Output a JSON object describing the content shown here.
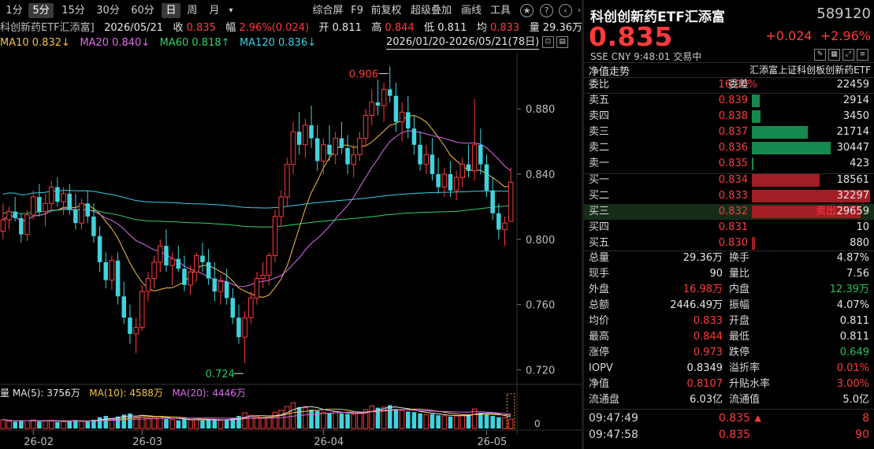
{
  "toolbar": {
    "periods": [
      "1分",
      "5分",
      "15分",
      "30分",
      "60分",
      "日",
      "周",
      "月"
    ],
    "active_period": "日",
    "tools": [
      "综合屏",
      "F9",
      "前复权",
      "超级叠加",
      "画线",
      "工具"
    ],
    "icons": [
      "star-icon",
      "help-icon",
      "chevron-left-icon",
      "chevron-right-icon"
    ]
  },
  "info": {
    "name": "科创新药ETF汇添富]",
    "date": "2026/05/21",
    "close_label": "收",
    "close": "0.835",
    "amp_label": "幅",
    "amp": "2.96%(0.024)",
    "open_label": "开",
    "open": "0.811",
    "high_label": "高",
    "high": "0.844",
    "low_label": "低",
    "low": "0.811",
    "avg_label": "均",
    "avg": "0.833",
    "vol_label": "量",
    "vol": "29.36万",
    "ma10": "MA10 0.832↓",
    "ma20": "MA20 0.840↓",
    "ma60": "MA60 0.818↑",
    "ma120": "MA120 0.836↓",
    "range": "2026/01/20-2026/05/21(78日)"
  },
  "volume_legend": {
    "vol_label": "量",
    "ma5": "MA(5): 3756万",
    "ma10": "MA(10): 4588万",
    "ma20": "MA(20): 4446万"
  },
  "chart_data": {
    "type": "candlestick",
    "y_ticks": [
      "0.880",
      "0.840",
      "0.800",
      "0.760",
      "0.720"
    ],
    "y_tick_values": [
      0.88,
      0.84,
      0.8,
      0.76,
      0.72
    ],
    "ylim": [
      0.712,
      0.912
    ],
    "x_labels": [
      "26-02",
      "26-03",
      "26-04",
      "26-05"
    ],
    "x_label_index": [
      5,
      23,
      53,
      80
    ],
    "max_label": "0.906",
    "min_label": "0.724",
    "max_index": 64,
    "min_index": 40,
    "vol_ticks": [
      "0"
    ],
    "vol_max": 1.0,
    "ohlc": [
      [
        0.805,
        0.822,
        0.8,
        0.812
      ],
      [
        0.812,
        0.82,
        0.806,
        0.817
      ],
      [
        0.817,
        0.826,
        0.811,
        0.813
      ],
      [
        0.813,
        0.816,
        0.798,
        0.803
      ],
      [
        0.803,
        0.818,
        0.799,
        0.815
      ],
      [
        0.815,
        0.83,
        0.812,
        0.826
      ],
      [
        0.826,
        0.834,
        0.814,
        0.817
      ],
      [
        0.817,
        0.828,
        0.808,
        0.822
      ],
      [
        0.822,
        0.836,
        0.818,
        0.832
      ],
      [
        0.832,
        0.838,
        0.82,
        0.823
      ],
      [
        0.823,
        0.832,
        0.815,
        0.828
      ],
      [
        0.828,
        0.834,
        0.815,
        0.818
      ],
      [
        0.818,
        0.828,
        0.806,
        0.81
      ],
      [
        0.81,
        0.825,
        0.806,
        0.822
      ],
      [
        0.822,
        0.83,
        0.81,
        0.814
      ],
      [
        0.814,
        0.822,
        0.798,
        0.802
      ],
      [
        0.802,
        0.808,
        0.78,
        0.786
      ],
      [
        0.786,
        0.792,
        0.77,
        0.775
      ],
      [
        0.775,
        0.79,
        0.769,
        0.787
      ],
      [
        0.787,
        0.792,
        0.76,
        0.765
      ],
      [
        0.765,
        0.774,
        0.748,
        0.752
      ],
      [
        0.752,
        0.76,
        0.736,
        0.742
      ],
      [
        0.742,
        0.752,
        0.73,
        0.746
      ],
      [
        0.746,
        0.772,
        0.744,
        0.768
      ],
      [
        0.768,
        0.78,
        0.762,
        0.776
      ],
      [
        0.776,
        0.79,
        0.77,
        0.786
      ],
      [
        0.786,
        0.8,
        0.78,
        0.796
      ],
      [
        0.796,
        0.806,
        0.78,
        0.784
      ],
      [
        0.784,
        0.792,
        0.772,
        0.788
      ],
      [
        0.788,
        0.796,
        0.78,
        0.782
      ],
      [
        0.782,
        0.79,
        0.768,
        0.772
      ],
      [
        0.772,
        0.784,
        0.766,
        0.78
      ],
      [
        0.78,
        0.792,
        0.774,
        0.79
      ],
      [
        0.79,
        0.798,
        0.78,
        0.786
      ],
      [
        0.786,
        0.794,
        0.772,
        0.776
      ],
      [
        0.776,
        0.786,
        0.762,
        0.768
      ],
      [
        0.768,
        0.778,
        0.76,
        0.774
      ],
      [
        0.774,
        0.782,
        0.76,
        0.764
      ],
      [
        0.764,
        0.77,
        0.748,
        0.752
      ],
      [
        0.752,
        0.76,
        0.736,
        0.74
      ],
      [
        0.74,
        0.756,
        0.724,
        0.752
      ],
      [
        0.752,
        0.768,
        0.748,
        0.764
      ],
      [
        0.764,
        0.78,
        0.76,
        0.776
      ],
      [
        0.776,
        0.786,
        0.77,
        0.778
      ],
      [
        0.778,
        0.792,
        0.772,
        0.79
      ],
      [
        0.79,
        0.818,
        0.786,
        0.814
      ],
      [
        0.814,
        0.83,
        0.808,
        0.826
      ],
      [
        0.826,
        0.85,
        0.82,
        0.846
      ],
      [
        0.846,
        0.872,
        0.84,
        0.866
      ],
      [
        0.866,
        0.878,
        0.852,
        0.858
      ],
      [
        0.858,
        0.874,
        0.85,
        0.87
      ],
      [
        0.87,
        0.882,
        0.856,
        0.862
      ],
      [
        0.862,
        0.87,
        0.842,
        0.848
      ],
      [
        0.848,
        0.862,
        0.84,
        0.858
      ],
      [
        0.858,
        0.87,
        0.848,
        0.852
      ],
      [
        0.852,
        0.866,
        0.846,
        0.862
      ],
      [
        0.862,
        0.872,
        0.852,
        0.856
      ],
      [
        0.856,
        0.864,
        0.84,
        0.846
      ],
      [
        0.846,
        0.858,
        0.838,
        0.852
      ],
      [
        0.852,
        0.866,
        0.848,
        0.862
      ],
      [
        0.862,
        0.88,
        0.858,
        0.876
      ],
      [
        0.876,
        0.892,
        0.87,
        0.884
      ],
      [
        0.884,
        0.898,
        0.876,
        0.882
      ],
      [
        0.882,
        0.896,
        0.872,
        0.892
      ],
      [
        0.892,
        0.906,
        0.884,
        0.888
      ],
      [
        0.888,
        0.896,
        0.866,
        0.872
      ],
      [
        0.872,
        0.884,
        0.86,
        0.878
      ],
      [
        0.878,
        0.888,
        0.862,
        0.868
      ],
      [
        0.868,
        0.876,
        0.852,
        0.858
      ],
      [
        0.858,
        0.866,
        0.842,
        0.846
      ],
      [
        0.846,
        0.858,
        0.84,
        0.852
      ],
      [
        0.852,
        0.862,
        0.836,
        0.84
      ],
      [
        0.84,
        0.85,
        0.828,
        0.832
      ],
      [
        0.832,
        0.844,
        0.826,
        0.84
      ],
      [
        0.84,
        0.848,
        0.826,
        0.83
      ],
      [
        0.83,
        0.842,
        0.824,
        0.838
      ],
      [
        0.838,
        0.85,
        0.832,
        0.846
      ],
      [
        0.846,
        0.858,
        0.838,
        0.842
      ],
      [
        0.842,
        0.886,
        0.836,
        0.858
      ],
      [
        0.858,
        0.868,
        0.84,
        0.846
      ],
      [
        0.846,
        0.852,
        0.826,
        0.83
      ],
      [
        0.83,
        0.838,
        0.812,
        0.816
      ],
      [
        0.816,
        0.822,
        0.8,
        0.806
      ],
      [
        0.806,
        0.814,
        0.796,
        0.81
      ],
      [
        0.811,
        0.844,
        0.811,
        0.835
      ]
    ],
    "volumes": [
      0.28,
      0.24,
      0.22,
      0.26,
      0.25,
      0.27,
      0.22,
      0.24,
      0.26,
      0.21,
      0.22,
      0.24,
      0.27,
      0.23,
      0.22,
      0.28,
      0.36,
      0.4,
      0.31,
      0.38,
      0.44,
      0.48,
      0.36,
      0.42,
      0.33,
      0.35,
      0.38,
      0.3,
      0.28,
      0.26,
      0.3,
      0.27,
      0.28,
      0.25,
      0.27,
      0.3,
      0.26,
      0.29,
      0.34,
      0.4,
      0.5,
      0.42,
      0.38,
      0.34,
      0.36,
      0.52,
      0.58,
      0.7,
      0.82,
      0.68,
      0.66,
      0.6,
      0.56,
      0.52,
      0.5,
      0.54,
      0.48,
      0.46,
      0.44,
      0.5,
      0.6,
      0.72,
      0.66,
      0.68,
      0.74,
      0.62,
      0.58,
      0.54,
      0.52,
      0.48,
      0.44,
      0.46,
      0.42,
      0.4,
      0.38,
      0.4,
      0.42,
      0.44,
      0.62,
      0.5,
      0.44,
      0.4,
      0.36,
      0.34,
      0.3
    ],
    "ma_lines": {
      "ma10": {
        "color": "#f5c242",
        "last": 0.832
      },
      "ma20": {
        "color": "#e06bf0",
        "last": 0.84
      },
      "ma60": {
        "color": "#2fd36b",
        "last": 0.818
      },
      "ma120": {
        "color": "#35d0e6",
        "last": 0.836
      }
    }
  },
  "quote": {
    "title": "科创创新药ETF汇添富",
    "code": "589120",
    "price": "0.835",
    "change": "+0.024",
    "change_pct": "+2.96%",
    "meta": "SSE  CNY  9:48:01  交易中",
    "nav_trend": "净值走势",
    "fund_full_name": "汇添富上证科创板创新药ETF",
    "commit_ratio_label": "委比",
    "commit_ratio": "16.00%",
    "commit_diff_label": "委差",
    "commit_diff": "22459",
    "asks": [
      {
        "label": "卖五",
        "price": "0.839",
        "vol": "2914",
        "ratio": 0.096
      },
      {
        "label": "卖四",
        "price": "0.838",
        "vol": "3450",
        "ratio": 0.113
      },
      {
        "label": "卖三",
        "price": "0.837",
        "vol": "21714",
        "ratio": 0.713
      },
      {
        "label": "卖二",
        "price": "0.836",
        "vol": "30447",
        "ratio": 1.0
      },
      {
        "label": "卖一",
        "price": "0.835",
        "vol": "423",
        "ratio": 0.014
      }
    ],
    "bids": [
      {
        "label": "买一",
        "price": "0.834",
        "vol": "18561",
        "ratio": 0.575
      },
      {
        "label": "买二",
        "price": "0.833",
        "vol": "32297",
        "ratio": 1.0
      },
      {
        "label": "买三",
        "price": "0.832",
        "vol": "29659",
        "ratio": 0.918,
        "tag": "卖出"
      },
      {
        "label": "买四",
        "price": "0.831",
        "vol": "10",
        "ratio": 0.0
      },
      {
        "label": "买五",
        "price": "0.830",
        "vol": "880",
        "ratio": 0.027
      }
    ],
    "stats": [
      {
        "k": "总量",
        "v": "29.36万",
        "c": "#e6e6e6",
        "k2": "换手",
        "v2": "4.87%",
        "c2": "#e6e6e6"
      },
      {
        "k": "现手",
        "v": "90",
        "c": "#e6e6e6",
        "k2": "量比",
        "v2": "7.56",
        "c2": "#e6e6e6"
      },
      {
        "k": "外盘",
        "v": "16.98万",
        "c": "#ff3b3b",
        "k2": "内盘",
        "v2": "12.39万",
        "c2": "#22c55e"
      },
      {
        "k": "总额",
        "v": "2446.49万",
        "c": "#e6e6e6",
        "k2": "振幅",
        "v2": "4.07%",
        "c2": "#e6e6e6"
      },
      {
        "k": "均价",
        "v": "0.833",
        "c": "#ff3b3b",
        "k2": "开盘",
        "v2": "0.811",
        "c2": "#e6e6e6"
      },
      {
        "k": "最高",
        "v": "0.844",
        "c": "#ff3b3b",
        "k2": "最低",
        "v2": "0.811",
        "c2": "#e6e6e6"
      },
      {
        "k": "涨停",
        "v": "0.973",
        "c": "#ff3b3b",
        "k2": "跌停",
        "v2": "0.649",
        "c2": "#22c55e"
      },
      {
        "k": "IOPV",
        "v": "0.8349",
        "c": "#e6e6e6",
        "k2": "溢折率",
        "v2": "0.01%",
        "c2": "#ff3b3b"
      },
      {
        "k": "净值",
        "v": "0.8107",
        "c": "#ff3b3b",
        "k2": "升贴水率",
        "v2": "3.00%",
        "c2": "#ff3b3b"
      },
      {
        "k": "流通盘",
        "v": "6.03亿",
        "c": "#e6e6e6",
        "k2": "流通值",
        "v2": "5.0亿",
        "c2": "#e6e6e6"
      }
    ],
    "ticks": [
      {
        "time": "09:47:49",
        "price": "0.835",
        "arrow": "▲",
        "vol": "8",
        "vc": "#ff3b3b"
      },
      {
        "time": "09:47:58",
        "price": "0.835",
        "arrow": "",
        "vol": "90",
        "vc": "#ff3b3b"
      }
    ]
  }
}
